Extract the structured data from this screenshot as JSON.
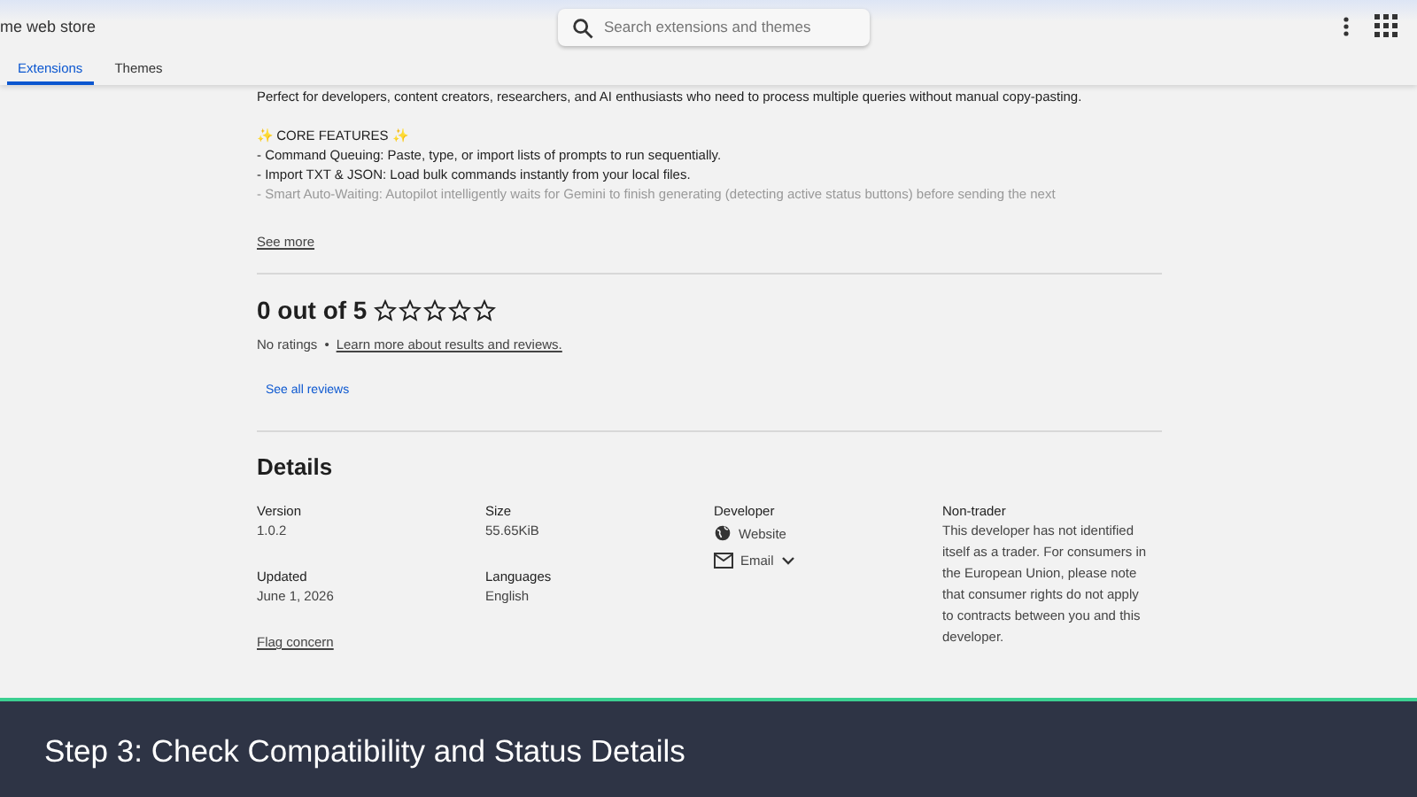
{
  "header": {
    "store_name": "me web store",
    "search": {
      "placeholder": "Search extensions and themes"
    }
  },
  "tabs": [
    {
      "label": "Extensions",
      "selected": true
    },
    {
      "label": "Themes",
      "selected": false
    }
  ],
  "description": {
    "intro": "Perfect for developers, content creators, researchers, and AI enthusiasts who need to process multiple queries without manual copy-pasting.",
    "features_heading": "✨ CORE FEATURES ✨",
    "lines": [
      {
        "text": "- Command Queuing: Paste, type, or import lists of prompts to run sequentially.",
        "faded": false
      },
      {
        "text": "- Import TXT & JSON: Load bulk commands instantly from your local files.",
        "faded": false
      },
      {
        "text": "- Smart Auto-Waiting: Autopilot intelligently waits for Gemini to finish generating (detecting active status buttons) before sending the next",
        "faded": true
      }
    ],
    "see_more": "See more"
  },
  "rating": {
    "title": "0 out of 5",
    "stars": 0,
    "count": "No ratings",
    "separator": "•",
    "learn_more": "Learn more about results and reviews.",
    "see_all": "See all reviews"
  },
  "details": {
    "title": "Details",
    "version_label": "Version",
    "version": "1.0.2",
    "updated_label": "Updated",
    "updated": "June 1, 2026",
    "size_label": "Size",
    "size": "55.65KiB",
    "languages_label": "Languages",
    "languages": "English",
    "developer_label": "Developer",
    "website": "Website",
    "email": "Email",
    "non_trader_label": "Non-trader",
    "non_trader_text": "This developer has not identified itself as a trader. For consumers in the European Union, please note that consumer rights do not apply to contracts between you and this developer.",
    "flag": "Flag concern"
  },
  "caption": "Step 3: Check Compatibility and Status Details"
}
